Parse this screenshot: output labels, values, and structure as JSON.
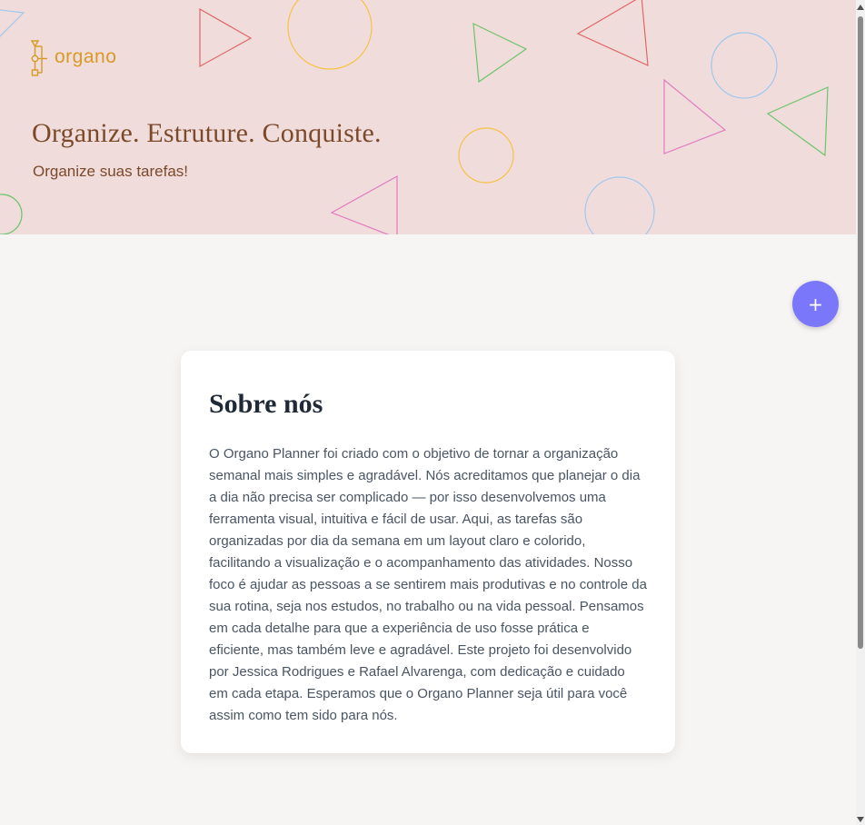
{
  "header": {
    "logo_text": "organo",
    "title": "Organize. Estruture. Conquiste.",
    "subtitle": "Organize suas tarefas!"
  },
  "fab": {
    "label": "+"
  },
  "about": {
    "title": "Sobre nós",
    "text": "O Organo Planner foi criado com o objetivo de tornar a organização semanal mais simples e agradável. Nós acreditamos que planejar o dia a dia não precisa ser complicado — por isso desenvolvemos uma ferramenta visual, intuitiva e fácil de usar. Aqui, as tarefas são organizadas por dia da semana em um layout claro e colorido, facilitando a visualização e o acompanhamento das atividades. Nosso foco é ajudar as pessoas a se sentirem mais produtivas e no controle da sua rotina, seja nos estudos, no trabalho ou na vida pessoal. Pensamos em cada detalhe para que a experiência de uso fosse prática e eficiente, mas também leve e agradável. Este projeto foi desenvolvido por Jessica Rodrigues e Rafael Alvarenga, com dedicação e cuidado em cada etapa. Esperamos que o Organo Planner seja útil para você assim como tem sido para nós."
  },
  "colors": {
    "hero_background": "#f1dcdc",
    "brand": "#d79a24",
    "heading_brown": "#7a4a2a",
    "fab_accent": "#7b77fb",
    "shape_red": "#e06666",
    "shape_yellow": "#f6c244",
    "shape_green": "#6cc46c",
    "shape_blue": "#9fc8ee",
    "shape_pink": "#e07ac0"
  },
  "icons": {
    "logo": "organo-logo-icon",
    "add": "plus-icon",
    "scroll_up": "scroll-up-arrow-icon",
    "scroll_down": "scroll-down-arrow-icon"
  }
}
